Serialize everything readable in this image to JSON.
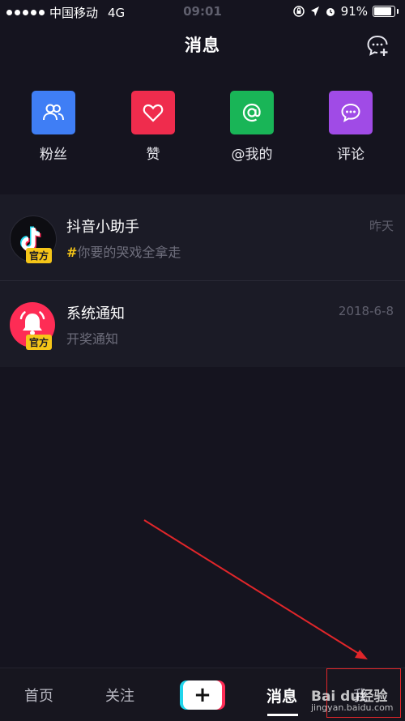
{
  "status_bar": {
    "carrier": "中国移动",
    "network": "4G",
    "time": "09:01",
    "battery": "91%"
  },
  "header": {
    "title": "消息"
  },
  "categories": [
    {
      "label": "粉丝",
      "icon": "fans-icon",
      "color": "#3f7ef5"
    },
    {
      "label": "赞",
      "icon": "heart-icon",
      "color": "#ef2c4d"
    },
    {
      "label": "@我的",
      "icon": "at-icon",
      "color": "#19b557"
    },
    {
      "label": "评论",
      "icon": "comment-icon",
      "color": "#a04be6"
    }
  ],
  "messages": [
    {
      "name": "抖音小助手",
      "preview": "你要的哭戏全拿走",
      "time": "昨天",
      "badge": "官方",
      "hashtag": "#"
    },
    {
      "name": "系统通知",
      "preview": "开奖通知",
      "time": "2018-6-8",
      "badge": "官方"
    }
  ],
  "tabbar": {
    "home": "首页",
    "follow": "关注",
    "plus": "+",
    "messages": "消息",
    "me": "我"
  },
  "watermark": {
    "brand": "Bai du经验",
    "url": "jingyan.baidu.com"
  }
}
